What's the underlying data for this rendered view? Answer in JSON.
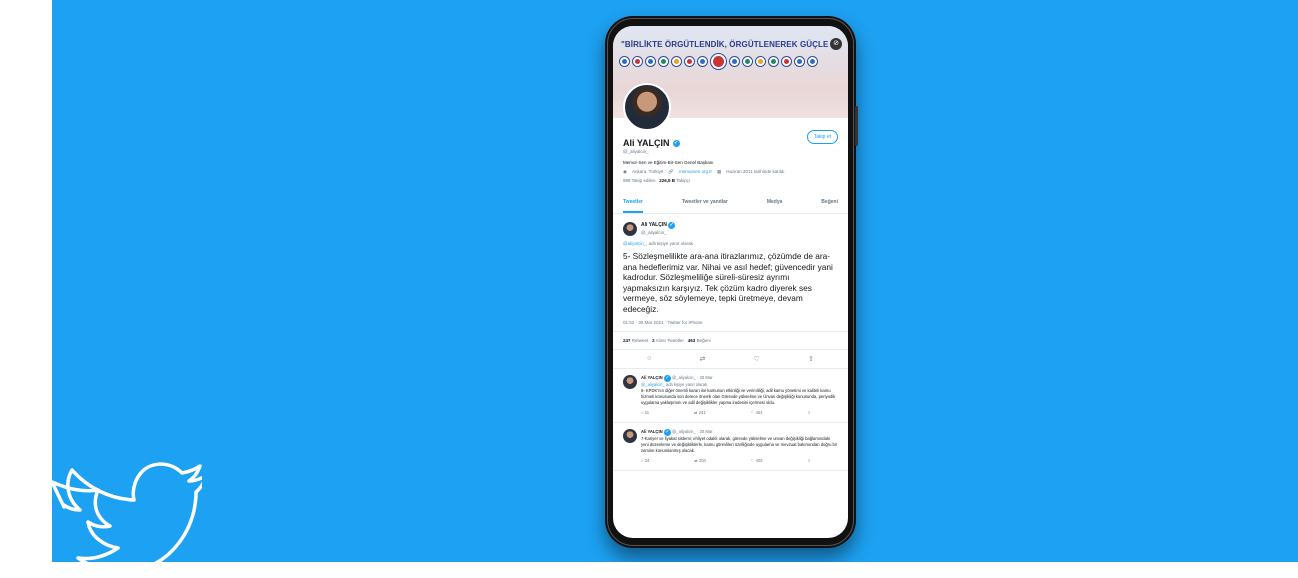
{
  "banner": {
    "title": "\"BİRLİKTE ÖRGÜTLENDİK, ÖRGÜTLENEREK GÜÇLE",
    "link_icon": "link-icon"
  },
  "profile": {
    "follow_label": "Takip et",
    "name": "Ali YALÇIN",
    "handle": "@_aliyalcin_",
    "bio": "Memur-Sen ve Eğitim-Bir-Sen Genel Başkanı",
    "location": "Ankara, Türkiye",
    "website": "memursen.org.tr",
    "joined": "Haziran 2011 tarihinde katıldı",
    "following": "988 Takip edilen",
    "followers_count": "226,9 B",
    "followers_label": "Takipçi"
  },
  "tabs": [
    "Tweetler",
    "Tweetler ve yanıtlar",
    "Medya",
    "Beğeni"
  ],
  "tweet": {
    "name": "Ali YALÇIN",
    "handle": "@_aliyalcin_",
    "reply_to_user": "@aliyalcin_",
    "reply_to_suffix": "adlı kişiye yanıt olarak",
    "text": "5- Sözleşmelilikte ara-ana itirazlarımız, çözümde de ara-ana hedeflerimiz var. Nihai ve asıl hedef; güvencedir yani kadrodur. Sözleşmeliliğe süreli-süresiz ayrımı yapmaksızın karşıyız. Tek çözüm kadro diyerek ses vermeye, söz söylemeye, tepki üretmeye, devam edeceğiz.",
    "meta": "01:52 · 30 Mar 2021 · Twitter for iPhone",
    "retweets": "247",
    "retweets_label": "Retweet",
    "quotes": "2",
    "quotes_label": "Alıntı Tweetler",
    "likes": "463",
    "likes_label": "Beğeni"
  },
  "replies": [
    {
      "name": "Ali YALÇIN",
      "meta": "@_aliyalcin_ · 30 Mar",
      "reply_user": "@_aliyalcin_",
      "reply_suffix": "adlı kişiye yanıt olarak",
      "text": "6- KPDK'nın diğer önemli kararı ise kamunun etkinliği ve verimliliği, adil kamu yönetimi ve kaliteli kamu hizmeti konusunda son derece önemli olan Görevde yükselme ve Ünvan değişikliği konusunda, periyodik uygulama yaklaşımını ve adil değişiklikler yapma iradesini içermesi oldu.",
      "c": "11",
      "rt": "241",
      "lk": "454"
    },
    {
      "name": "Ali YALÇIN",
      "meta": "@_aliyalcin_ · 30 Mar",
      "text": "7-Kariyer ve liyakat sistemi; ehliyet odaklı olarak, görevde yükselme ve unvan değişikliği bağlamındaki yeni düzenleme ve değişikliklerle, kamu görevlileri özelliğinde uygulama ve mevzuat bakımından doğru bir zemine konumlanmış olacak.",
      "c": "24",
      "rt": "204",
      "lk": "402"
    }
  ]
}
